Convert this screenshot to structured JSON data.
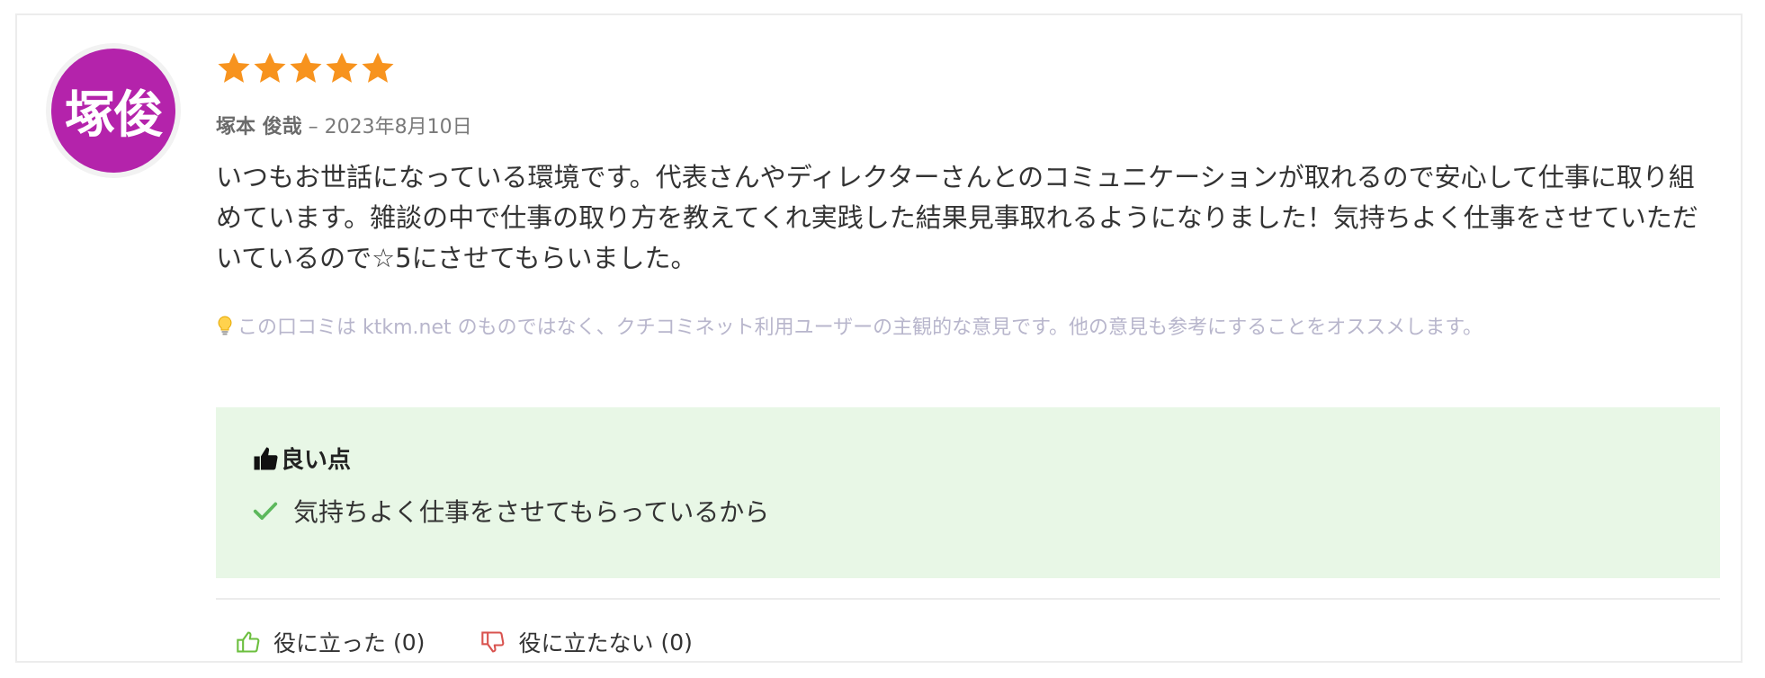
{
  "review": {
    "avatar_text": "塚俊",
    "rating": 5,
    "author": "塚本 俊哉",
    "date_sep": " – ",
    "date": "2023年8月10日",
    "body": "いつもお世話になっている環境です。代表さんやディレクターさんとのコミュニケーションが取れるので安心して仕事に取り組めています。雑談の中で仕事の取り方を教えてくれ実践した結果見事取れるようになりました！気持ちよく仕事をさせていただいているので☆5にさせてもらいました。",
    "disclaimer": "この口コミは ktkm.net のものではなく、クチコミネット利用ユーザーの主観的な意見です。他の意見も参考にすることをオススメします。"
  },
  "good_points": {
    "title": "良い点",
    "items": [
      "気持ちよく仕事をさせてもらっているから"
    ]
  },
  "votes": {
    "helpful_label": "役に立った",
    "helpful_count": "(0)",
    "not_helpful_label": "役に立たない",
    "not_helpful_count": "(0)"
  },
  "colors": {
    "avatar_bg": "#b423ab",
    "star": "#f7931e",
    "good_box_bg": "#e8f7e6",
    "check": "#5cb85c",
    "thumb_up": "#6cbf3f",
    "thumb_down": "#d9534f",
    "disclaimer_text": "#b8b6cc"
  },
  "icons": {
    "rating": "star-icon",
    "disclaimer": "lightbulb-icon",
    "good_title": "thumbs-up-icon",
    "good_item": "check-icon",
    "helpful": "thumbs-up-outline-icon",
    "not_helpful": "thumbs-down-outline-icon"
  }
}
